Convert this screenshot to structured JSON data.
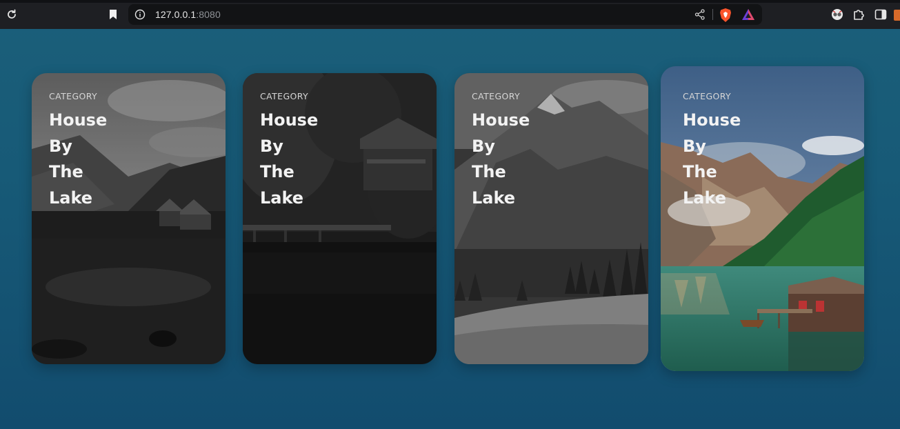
{
  "browser": {
    "url_host": "127.0.0.1",
    "url_port": ":8080",
    "icons": {
      "reload": "reload-icon",
      "bookmark": "bookmark-icon",
      "site_info": "info-icon",
      "share": "share-icon",
      "brave_shields": "brave-shields-icon",
      "brave_rewards": "brave-rewards-icon",
      "extension": "extension-icon",
      "puzzle": "puzzle-icon",
      "sidebar": "sidebar-icon"
    }
  },
  "cards": [
    {
      "category": "CATEGORY",
      "title_lines": [
        "House",
        "By",
        "The",
        "Lake"
      ],
      "state": "grayscale"
    },
    {
      "category": "CATEGORY",
      "title_lines": [
        "House",
        "By",
        "The",
        "Lake"
      ],
      "state": "grayscale"
    },
    {
      "category": "CATEGORY",
      "title_lines": [
        "House",
        "By",
        "The",
        "Lake"
      ],
      "state": "grayscale"
    },
    {
      "category": "CATEGORY",
      "title_lines": [
        "House",
        "By",
        "The",
        "Lake"
      ],
      "state": "color-hovered"
    }
  ],
  "colors": {
    "page_top": "#1b5f7a",
    "page_bottom": "#124c6e",
    "chrome": "#1e1f23",
    "omnibox": "#121315",
    "brave_orange": "#fb542b"
  }
}
